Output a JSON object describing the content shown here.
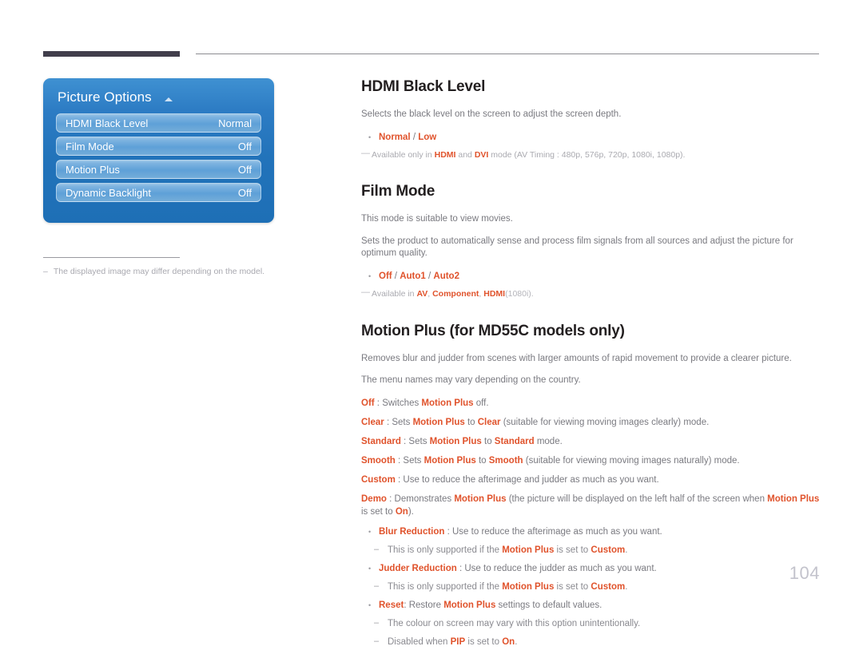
{
  "page": {
    "number": "104"
  },
  "osd": {
    "title": "Picture Options",
    "caret_icon": "triangle-up-icon",
    "rows": [
      {
        "label": "HDMI Black Level",
        "value": "Normal"
      },
      {
        "label": "Film Mode",
        "value": "Off"
      },
      {
        "label": "Motion Plus",
        "value": "Off"
      },
      {
        "label": "Dynamic Backlight",
        "value": "Off"
      }
    ]
  },
  "left_note": {
    "dash": "–",
    "text": "The displayed image may differ depending on the model."
  },
  "sections": {
    "hdmi_black_level": {
      "title": "HDMI Black Level",
      "body": "Selects the black level on the screen to adjust the screen depth.",
      "bullet_marker": "•",
      "option_a": "Normal",
      "option_sep": " / ",
      "option_b": "Low",
      "note_dash": "—",
      "note_pre": "Available only in ",
      "note_hdmi": "HDMI",
      "note_and": " and ",
      "note_dvi": "DVI",
      "note_post": " mode (AV Timing : 480p, 576p, 720p, 1080i, 1080p)."
    },
    "film_mode": {
      "title": "Film Mode",
      "body1": "This mode is suitable to view movies.",
      "body2": "Sets the product to automatically sense and process film signals from all sources and adjust the picture for optimum quality.",
      "bullet_marker": "•",
      "option_a": "Off",
      "sep1": " / ",
      "option_b": "Auto1",
      "sep2": " / ",
      "option_c": "Auto2",
      "note_dash": "—",
      "note_pre": "Available in ",
      "note_av": "AV",
      "note_c1": ", ",
      "note_component": "Component",
      "note_c2": ", ",
      "note_hdmi": "HDMI",
      "note_post": "(1080i)."
    },
    "motion_plus": {
      "title": "Motion Plus (for MD55C models only)",
      "body1": "Removes blur and judder from scenes with larger amounts of rapid movement to provide a clearer picture.",
      "body2": "The menu names may vary depending on the country.",
      "options": [
        {
          "name": "Off",
          "mid": " : Switches ",
          "ref": "Motion Plus",
          "tail": " off."
        },
        {
          "name": "Clear",
          "mid": " : Sets ",
          "ref": "Motion Plus",
          "mid2": " to ",
          "ref2": "Clear",
          "tail": " (suitable for viewing moving images clearly) mode."
        },
        {
          "name": "Standard",
          "mid": " : Sets ",
          "ref": "Motion Plus",
          "mid2": " to ",
          "ref2": "Standard",
          "tail": " mode."
        },
        {
          "name": "Smooth",
          "mid": " : Sets ",
          "ref": "Motion Plus",
          "mid2": " to ",
          "ref2": "Smooth",
          "tail": " (suitable for viewing moving images naturally) mode."
        },
        {
          "name": "Custom",
          "mid": " : Use to reduce the afterimage and judder as much as you want.",
          "ref": "",
          "tail": ""
        },
        {
          "name": "Demo",
          "mid": " : Demonstrates ",
          "ref": "Motion Plus",
          "mid2": " (the picture will be displayed on the left half of the screen when ",
          "ref2": "Motion Plus",
          "mid3": " is set to ",
          "ref3": "On",
          "tail": ")."
        }
      ],
      "bullet_marker": "•",
      "sub_marker": "–",
      "sub_items": [
        {
          "name": "Blur Reduction",
          "text": " : Use to reduce the afterimage as much as you want.",
          "subs": [
            {
              "pre": "This is only supported if the ",
              "ref": "Motion Plus",
              "mid": " is set to ",
              "ref2": "Custom",
              "post": "."
            }
          ]
        },
        {
          "name": "Judder Reduction",
          "text": " : Use to reduce the judder as much as you want.",
          "subs": [
            {
              "pre": "This is only supported if the ",
              "ref": "Motion Plus",
              "mid": " is set to ",
              "ref2": "Custom",
              "post": "."
            }
          ]
        },
        {
          "name": "Reset",
          "text_pre": ": Restore ",
          "ref": "Motion Plus",
          "text_post": " settings to default values.",
          "subs": [
            {
              "pre": "The colour on screen may vary with this option unintentionally.",
              "ref": "",
              "mid": "",
              "ref2": "",
              "post": ""
            },
            {
              "pre": "Disabled when ",
              "ref": "PIP",
              "mid": " is set to ",
              "ref2": "On",
              "post": "."
            }
          ]
        }
      ]
    }
  },
  "colors": {
    "accent": "#e0532c",
    "heading": "#231f20",
    "body": "#7a7a80",
    "panel_blue": "#1e6fb6",
    "rule_dark": "#413e4b"
  }
}
